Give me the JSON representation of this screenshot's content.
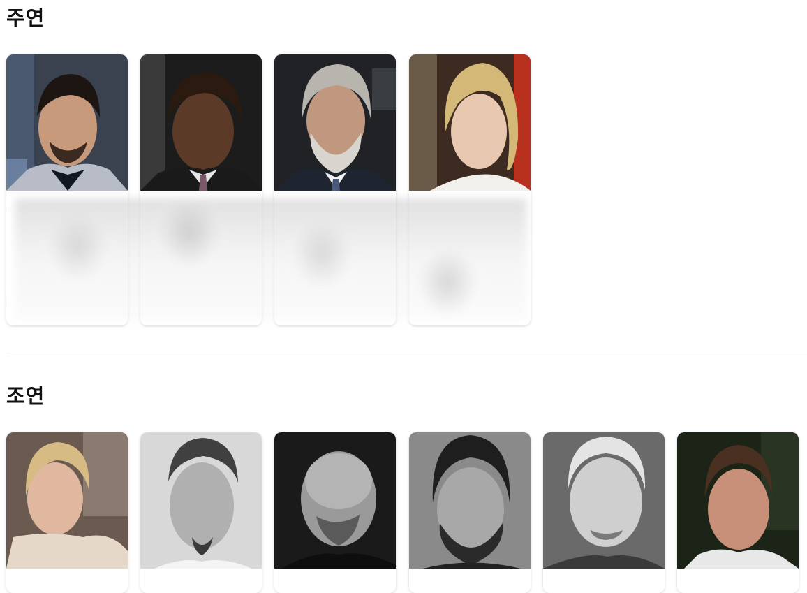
{
  "sections": {
    "main_cast": {
      "title": "주연",
      "cards": [
        {
          "photo": "person-photo-suit-smiling-goatee"
        },
        {
          "photo": "person-photo-curly-hair-suit"
        },
        {
          "photo": "person-photo-grey-hair-beard"
        },
        {
          "photo": "person-photo-blonde-hair-profile"
        }
      ]
    },
    "supporting_cast": {
      "title": "조연",
      "cards": [
        {
          "photo": "person-photo-blonde-woman-smiling"
        },
        {
          "photo": "person-photo-bw-receding-hair"
        },
        {
          "photo": "person-photo-bw-bald"
        },
        {
          "photo": "person-photo-bw-curly-beard"
        },
        {
          "photo": "person-photo-bw-older-man"
        },
        {
          "photo": "person-photo-color-balding-man"
        }
      ]
    }
  },
  "colors": {
    "card_shadow": "#d9d9d9",
    "divider": "#ececec",
    "title_text": "#111111"
  }
}
